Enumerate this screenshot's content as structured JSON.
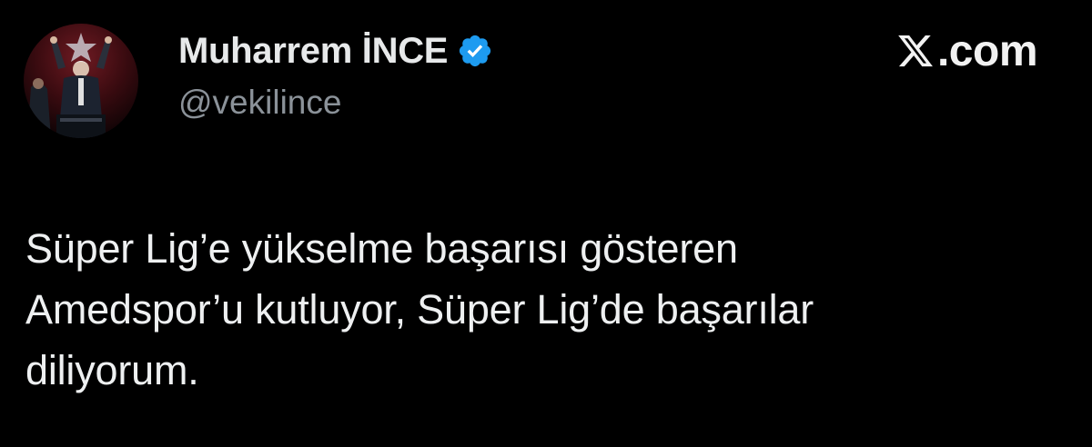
{
  "author": {
    "display_name": "Muharrem İNCE",
    "handle": "@vekilince",
    "verified": true,
    "avatar_icon": "profile-photo-avatar",
    "badge_icon": "verified-badge-icon",
    "badge_color": "#1d9bf0"
  },
  "brand": {
    "logo_icon": "x-logo-icon",
    "text": ".com"
  },
  "tweet": {
    "text": "Süper Lig’e yükselme başarısı gösteren\nAmedspor’u kutluyor, Süper Lig’de başarılar\ndiliyorum."
  },
  "colors": {
    "background": "#000000",
    "text": "#e7e9ea",
    "secondary_text": "#8b9299"
  }
}
